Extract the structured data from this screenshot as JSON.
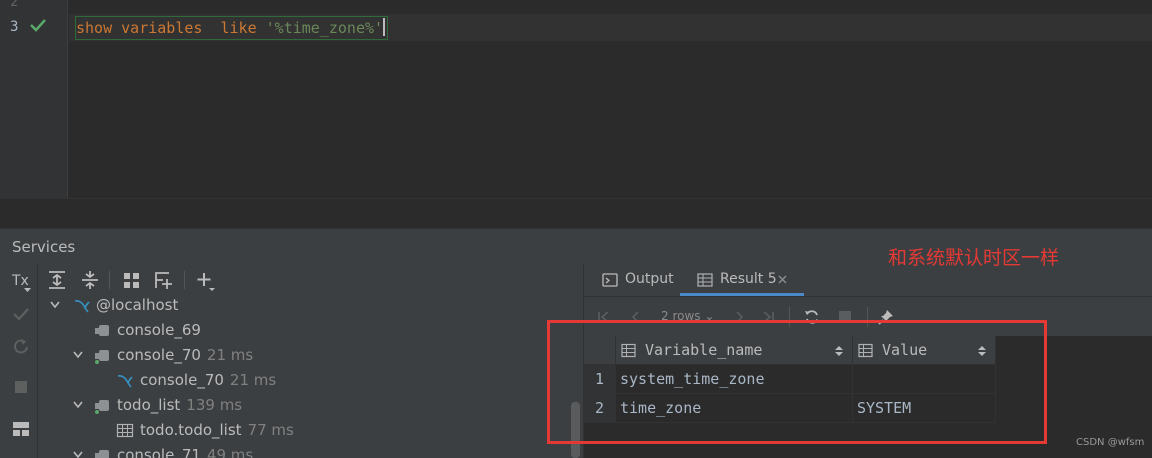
{
  "editor": {
    "line_numbers": [
      "2",
      "3"
    ],
    "query": {
      "kw1": "show",
      "kw2": "variables",
      "kw3": "like",
      "string": "'%time_zone%'"
    }
  },
  "services": {
    "title": "Services",
    "tx_label": "Tx",
    "tree": [
      {
        "label": "@localhost",
        "time": ""
      },
      {
        "label": "console_69",
        "time": ""
      },
      {
        "label": "console_70",
        "time": "21 ms"
      },
      {
        "label": "console_70",
        "time": "21 ms"
      },
      {
        "label": "todo_list",
        "time": "139 ms"
      },
      {
        "label": "todo.todo_list",
        "time": "77 ms"
      },
      {
        "label": "console_71",
        "time": "49 ms"
      }
    ]
  },
  "result": {
    "tabs": [
      {
        "label": "Output"
      },
      {
        "label": "Result 5"
      }
    ],
    "rows_label": "2 rows",
    "columns": [
      "Variable_name",
      "Value"
    ],
    "rows": [
      {
        "num": "1",
        "variable_name": "system_time_zone",
        "value": ""
      },
      {
        "num": "2",
        "variable_name": "time_zone",
        "value": "SYSTEM"
      }
    ]
  },
  "annotation": "和系统默认时区一样",
  "watermark": "CSDN @wfsm",
  "colors": {
    "keyword": "#cc7832",
    "string": "#6a8759",
    "annotation": "#e53935",
    "accent": "#4a88c7"
  }
}
